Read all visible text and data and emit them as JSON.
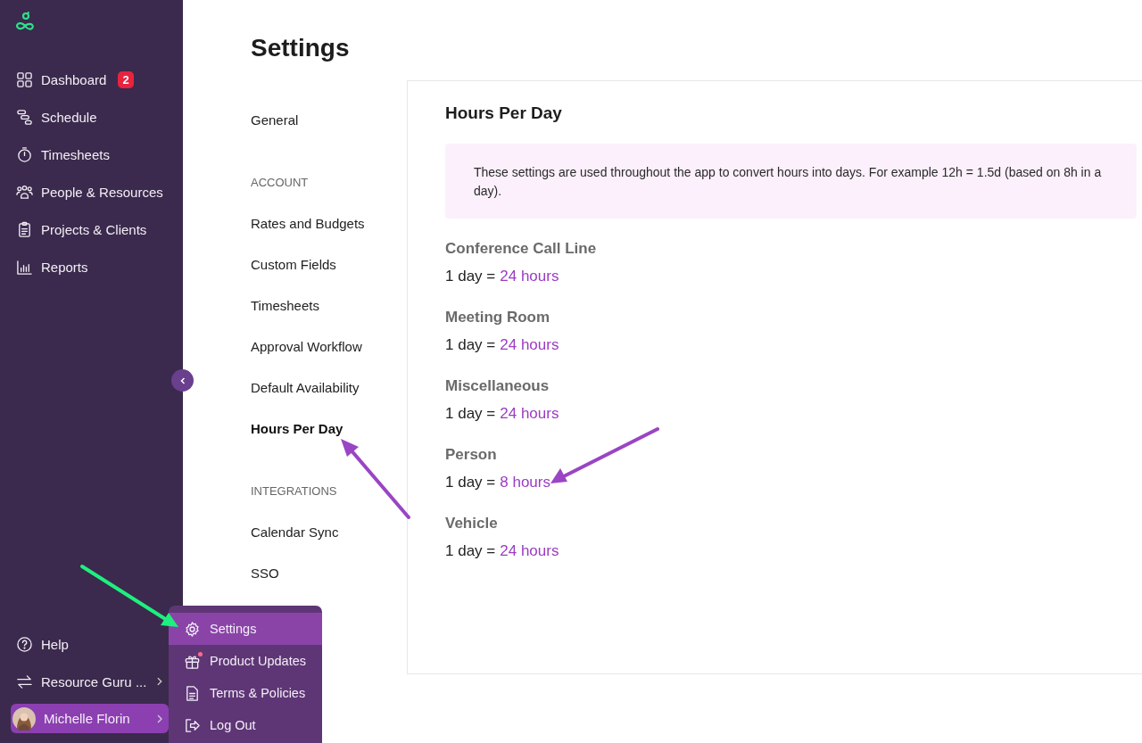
{
  "sidebar": {
    "items": [
      {
        "label": "Dashboard",
        "kind": "grid",
        "badge": "2"
      },
      {
        "label": "Schedule",
        "kind": "schedule"
      },
      {
        "label": "Timesheets",
        "kind": "stopwatch"
      },
      {
        "label": "People & Resources",
        "kind": "people"
      },
      {
        "label": "Projects & Clients",
        "kind": "clipboard"
      },
      {
        "label": "Reports",
        "kind": "chart"
      }
    ],
    "footer_items": [
      {
        "label": "Help",
        "kind": "help",
        "selected": false
      },
      {
        "label": "Resource Guru ...",
        "kind": "switch",
        "selected": false
      },
      {
        "label": "Michelle Florin",
        "kind": "user",
        "selected": true
      }
    ]
  },
  "page_title": "Settings",
  "settings_nav": [
    {
      "kind": "item",
      "label": "General",
      "selected": false
    },
    {
      "kind": "heading",
      "label": "ACCOUNT"
    },
    {
      "kind": "item",
      "label": "Rates and Budgets",
      "selected": false
    },
    {
      "kind": "item",
      "label": "Custom Fields",
      "selected": false
    },
    {
      "kind": "item",
      "label": "Timesheets",
      "selected": false
    },
    {
      "kind": "item",
      "label": "Approval Workflow",
      "selected": false
    },
    {
      "kind": "item",
      "label": "Default Availability",
      "selected": false
    },
    {
      "kind": "item",
      "label": "Hours Per Day",
      "selected": true
    },
    {
      "kind": "heading",
      "label": "INTEGRATIONS"
    },
    {
      "kind": "item",
      "label": "Calendar Sync",
      "selected": false
    },
    {
      "kind": "item",
      "label": "SSO",
      "selected": false
    }
  ],
  "panel": {
    "title": "Hours Per Day",
    "info": "These settings are used throughout the app to convert hours into days. For example 12h = 1.5d (based on 8h in a day).",
    "resources": [
      {
        "name": "Conference Call Line",
        "prefix": "1 day =",
        "value": "24 hours"
      },
      {
        "name": "Meeting Room",
        "prefix": "1 day =",
        "value": "24 hours"
      },
      {
        "name": "Miscellaneous",
        "prefix": "1 day =",
        "value": "24 hours"
      },
      {
        "name": "Person",
        "prefix": "1 day =",
        "value": "8 hours"
      },
      {
        "name": "Vehicle",
        "prefix": "1 day =",
        "value": "24 hours"
      }
    ]
  },
  "menu": {
    "items": [
      {
        "label": "Settings",
        "kind": "gear",
        "selected": true,
        "notification": false
      },
      {
        "label": "Product Updates",
        "kind": "gift",
        "selected": false,
        "notification": true
      },
      {
        "label": "Terms & Policies",
        "kind": "document",
        "selected": false,
        "notification": false
      },
      {
        "label": "Log Out",
        "kind": "logout",
        "selected": false,
        "notification": false
      }
    ]
  }
}
